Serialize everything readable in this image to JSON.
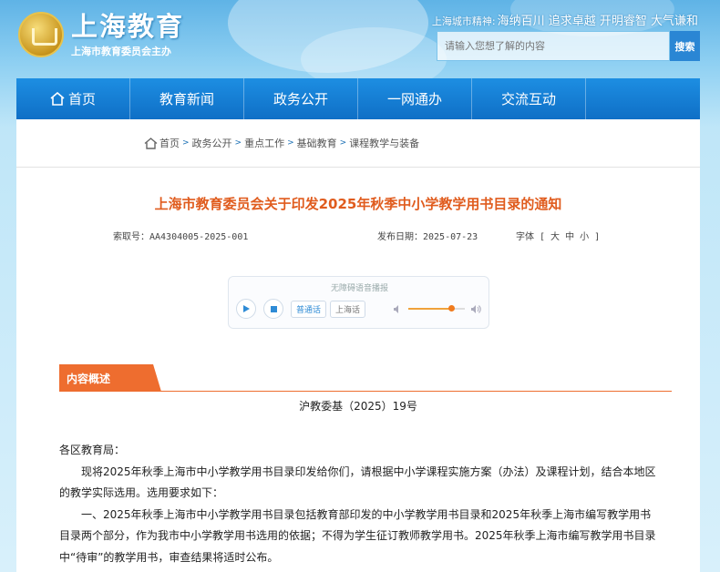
{
  "header": {
    "logo_title": "上海教育",
    "logo_subtitle": "上海市教育委员会主办",
    "motto_label": "上海城市精神:",
    "motto_text": "海纳百川 追求卓越 开明睿智 大气谦和",
    "search_placeholder": "请输入您想了解的内容",
    "search_button": "搜索"
  },
  "nav": {
    "items": [
      {
        "label": "首页",
        "icon": "home-icon"
      },
      {
        "label": "教育新闻"
      },
      {
        "label": "政务公开"
      },
      {
        "label": "一网通办"
      },
      {
        "label": "交流互动"
      },
      {
        "label": ""
      }
    ]
  },
  "breadcrumb": [
    "首页",
    "政务公开",
    "重点工作",
    "基础教育",
    "课程教学与装备"
  ],
  "article": {
    "title": "上海市教育委员会关于印发2025年秋季中小学教学用书目录的通知",
    "index_no": "索取号：AA4304005-2025-001",
    "publish_date": "发布日期：2025-07-23",
    "font_size_label": "字体 [ 大 中 小 ]",
    "doc_number": "沪教委基（2025）19号",
    "paragraphs": [
      "各区教育局：",
      "现将2025年秋季上海市中小学教学用书目录印发给你们，请根据中小学课程实施方案（办法）及课程计划，结合本地区的教学实际选用。选用要求如下：",
      "一、2025年秋季上海市中小学教学用书目录包括教育部印发的中小学教学用书目录和2025年秋季上海市编写教学用书目录两个部分，作为我市中小学教学用书选用的依据；不得为学生征订教师教学用书。2025年秋季上海市编写教学用书目录中“待审”的教学用书，审查结果将适时公布。"
    ]
  },
  "player": {
    "label": "无障碍语音播报",
    "tags": [
      "普通话",
      "上海话"
    ],
    "volume": 0.75
  },
  "summary_tab": "内容概述",
  "colors": {
    "nav_bg": "#1583d8",
    "title": "#e05c1e",
    "summary_tab": "#ee6d2f",
    "accent_blue": "#2a86d4"
  }
}
